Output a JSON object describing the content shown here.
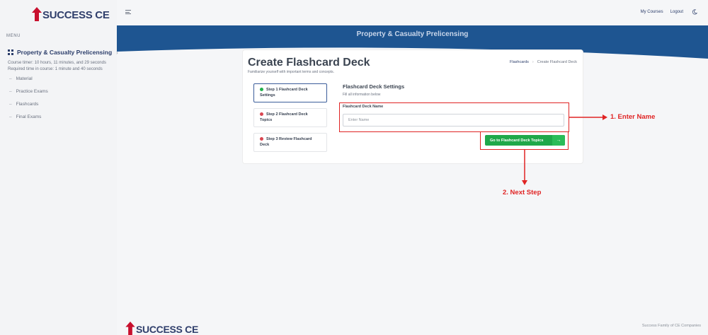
{
  "brand": {
    "name": "SUCCESS CE",
    "logo_color": "#c8102e"
  },
  "sidebar": {
    "menu_label": "MENU",
    "course_title": "Property & Casualty Prelicensing",
    "course_timer": "Course timer: 10 hours, 11 minutes, and 29 seconds",
    "required_time": "Required time in course: 1 minute and 40 seconds",
    "items": [
      {
        "label": "Material"
      },
      {
        "label": "Practice Exams"
      },
      {
        "label": "Flashcards"
      },
      {
        "label": "Final Exams"
      }
    ]
  },
  "header": {
    "links": {
      "my_courses": "My Courses",
      "logout": "Logout"
    }
  },
  "banner": {
    "title": "Property & Casualty Prelicensing",
    "color": "#1e5591"
  },
  "card": {
    "title": "Create Flashcard Deck",
    "subtitle": "Familiarize yourself with important terms and concepts.",
    "breadcrumb": {
      "parent": "Flashcards",
      "current": "Create Flashcard Deck"
    },
    "steps": [
      {
        "label": "Step 1  Flashcard Deck Settings",
        "status": "complete"
      },
      {
        "label": "Step 2  Flashcard Deck Topics",
        "status": "incomplete"
      },
      {
        "label": "Step 3  Review Flashcard Deck",
        "status": "incomplete"
      }
    ],
    "section_title": "Flashcard Deck Settings",
    "section_subtitle": "Fill all information below",
    "field_label": "Flashcard Deck Name",
    "field_placeholder": "Enter Name",
    "field_value": "",
    "next_button": "Go to Flashcard Deck Topics"
  },
  "annotations": {
    "enter_name": "1. Enter Name",
    "next_step": "2. Next Step",
    "color": "#e02424"
  },
  "footer": {
    "text": "Success Family of CE Companies"
  }
}
